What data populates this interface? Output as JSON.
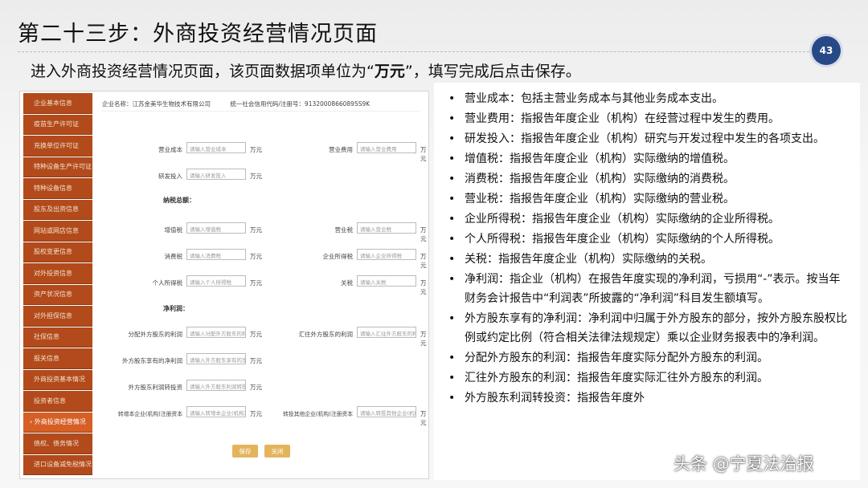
{
  "slide": {
    "title": "第二十三步：外商投资经营情况页面",
    "page_number": "43",
    "subtitle_prefix": "进入外商投资经营情况页面，该页面数据项单位为“",
    "subtitle_unit": "万元",
    "subtitle_suffix": "”，填写完成后点击保存。"
  },
  "sidebar": {
    "items": [
      {
        "label": "企业基本信息"
      },
      {
        "label": "疫苗生产许可证"
      },
      {
        "label": "充换单位许可证"
      },
      {
        "label": "特种设备生产许可证"
      },
      {
        "label": "特种设备信息"
      },
      {
        "label": "股东及出资信息"
      },
      {
        "label": "网站或网店信息"
      },
      {
        "label": "股权变更信息"
      },
      {
        "label": "对外投资信息"
      },
      {
        "label": "资产状况信息"
      },
      {
        "label": "对外担保信息"
      },
      {
        "label": "社保信息"
      },
      {
        "label": "报关信息"
      },
      {
        "label": "外商投资基本情况"
      },
      {
        "label": "投资者信息"
      },
      {
        "label": "› 外商投资经营情况"
      },
      {
        "label": "债权、债务情况"
      },
      {
        "label": "进口设备减免税情况"
      }
    ],
    "active_index": 15
  },
  "form": {
    "company_name": "企业名称：江苏金美华生物技术有限公司",
    "credit_code": "统一社会信用代码/注册号：91320008660895S9K",
    "unit": "万元",
    "fields": {
      "operating_cost": {
        "label": "营业成本",
        "placeholder": "请输入营业成本"
      },
      "operating_expense": {
        "label": "营业费用",
        "placeholder": "请输入营业费用"
      },
      "rd_investment": {
        "label": "研发投入",
        "placeholder": "请输入研发投入"
      },
      "vat": {
        "label": "增值税",
        "placeholder": "请输入增值税"
      },
      "business_tax": {
        "label": "营业税",
        "placeholder": "请输入营业税"
      },
      "consumption_tax": {
        "label": "消费税",
        "placeholder": "请输入消费税"
      },
      "corporate_income_tax": {
        "label": "企业所得税",
        "placeholder": "请输入企业所得税"
      },
      "personal_income_tax": {
        "label": "个人所得税",
        "placeholder": "请输入个人所得税"
      },
      "customs_duty": {
        "label": "关税",
        "placeholder": "请输入关税"
      },
      "profit_to_foreign": {
        "label": "分配外方股东的利润",
        "placeholder": "请输入分配外方股东的利润"
      },
      "remitted_profit": {
        "label": "汇往外方股东的利润",
        "placeholder": "请输入汇往外方股东的利润"
      },
      "foreign_net_profit": {
        "label": "外方股东享有的净利润",
        "placeholder": "请输入外方股东享有的净利润"
      },
      "foreign_profit_reinvest": {
        "label": "外方股东利润转投资",
        "placeholder": "请输入外方股东利润转投资"
      },
      "reinvest_domestic_capital": {
        "label": "转增本企业(机构)注册资本",
        "placeholder": "请输入转增本企业(机构)注册资本"
      },
      "reinvest_other_capital": {
        "label": "转投其他企业(机构)注册资本",
        "placeholder": "请输入转投其他企业(机构)注册资本"
      }
    },
    "section_total_tax": "纳税总额：",
    "section_net_profit": "净利润：",
    "save_button": "保存",
    "close_button": "关闭"
  },
  "definitions": [
    "营业成本：包括主营业务成本与其他业务成本支出。",
    "营业费用：指报告年度企业（机构）在经营过程中发生的费用。",
    "研发投入：指报告年度企业（机构）研究与开发过程中发生的各项支出。",
    "增值税：指报告年度企业（机构）实际缴纳的增值税。",
    "消费税：指报告年度企业（机构）实际缴纳的消费税。",
    "营业税：指报告年度企业（机构）实际缴纳的营业税。",
    "企业所得税：指报告年度企业（机构）实际缴纳的企业所得税。",
    "个人所得税：指报告年度企业（机构）实际缴纳的个人所得税。",
    "关税：指报告年度企业（机构）实际缴纳的关税。",
    "净利润：指企业（机构）在报告年度实现的净利润，亏损用“-”表示。按当年财务会计报告中“利润表”所披露的“净利润”科目发生额填写。",
    "外方股东享有的净利润：净利润中归属于外方股东的部分，按外方股东股权比例或约定比例（符合相关法律法规规定）乘以企业财务报表中的净利润。",
    "分配外方股东的利润：指报告年度实际分配外方股东的利润。",
    "汇往外方股东的利润：指报告年度实际汇往外方股东的利润。",
    "外方股东利润转投资：指报告年度外"
  ],
  "watermark": "头条 @宁夏法治报"
}
